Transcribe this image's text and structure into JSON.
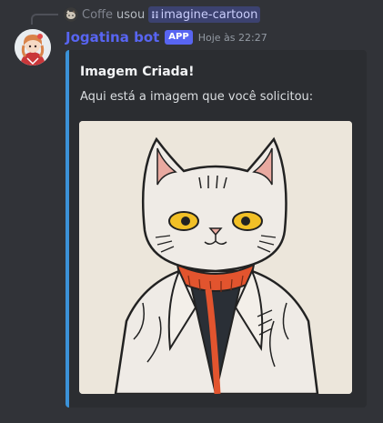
{
  "reply": {
    "user": "Coffe",
    "verb": "usou",
    "command": "imagine-cartoon",
    "command_icon": "slash-command-icon"
  },
  "author": {
    "name": "Jogatina bot",
    "badge": "APP",
    "timestamp": "Hoje às 22:27",
    "name_color": "#5865f2"
  },
  "embed": {
    "title": "Imagem Criada!",
    "description": "Aqui está a imagem que você solicitou:",
    "accent_color": "#3b92d8",
    "image_alt": "cartoon-cat-illustration"
  }
}
